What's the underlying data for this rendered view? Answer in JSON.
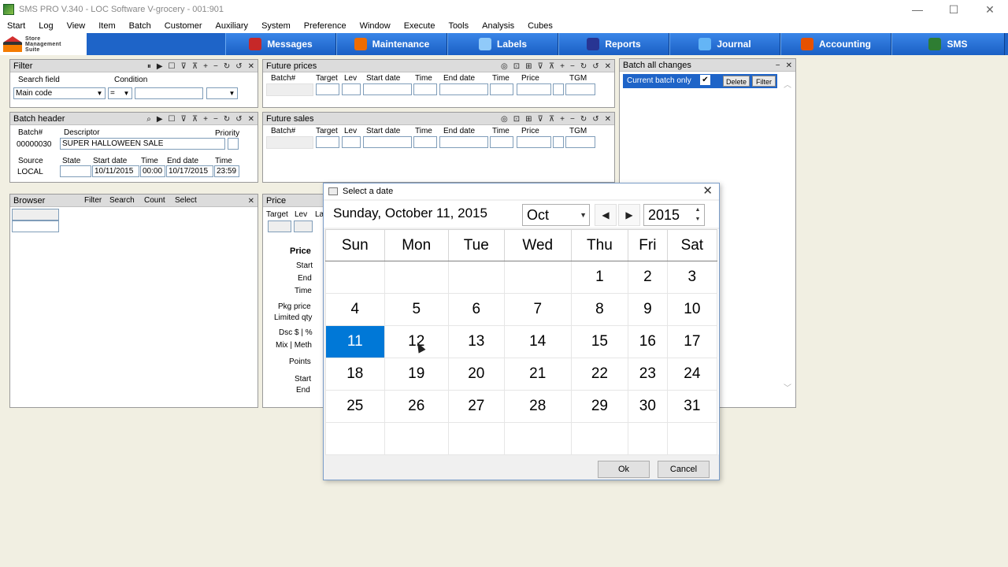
{
  "window": {
    "title": "SMS PRO V.340 - LOC Software V-grocery - 001:901",
    "minimize": "—",
    "maximize": "☐",
    "close": "✕"
  },
  "menu": [
    "Start",
    "Log",
    "View",
    "Item",
    "Batch",
    "Customer",
    "Auxiliary",
    "System",
    "Preference",
    "Window",
    "Execute",
    "Tools",
    "Analysis",
    "Cubes"
  ],
  "logo": {
    "line1": "Store",
    "line2": "Management",
    "line3": "Suite"
  },
  "toolbar": [
    {
      "label": "Messages",
      "color": "#c62828"
    },
    {
      "label": "Maintenance",
      "color": "#ef6c00"
    },
    {
      "label": "Labels",
      "color": "#1565c0"
    },
    {
      "label": "Reports",
      "color": "#283593"
    },
    {
      "label": "Journal",
      "color": "#1976d2"
    },
    {
      "label": "Accounting",
      "color": "#e65100"
    },
    {
      "label": "SMS",
      "color": "#2e7d32"
    }
  ],
  "filter": {
    "title": "Filter",
    "search_field_label": "Search field",
    "condition_label": "Condition",
    "search_field_value": "Main code",
    "condition_value": "="
  },
  "batch_header": {
    "title": "Batch header",
    "batch_label": "Batch#",
    "descriptor_label": "Descriptor",
    "priority_label": "Priority",
    "batch_no": "00000030",
    "descriptor": "SUPER HALLOWEEN SALE",
    "source_label": "Source",
    "state_label": "State",
    "start_date_label": "Start date",
    "time_label": "Time",
    "end_date_label": "End date",
    "time2_label": "Time",
    "source": "LOCAL",
    "start_date": "10/11/2015",
    "start_time": "00:00",
    "end_date": "10/17/2015",
    "end_time": "23:59"
  },
  "browser": {
    "title": "Browser",
    "filter": "Filter",
    "search": "Search",
    "count": "Count",
    "select": "Select"
  },
  "future_prices": {
    "title": "Future prices",
    "columns": [
      "Batch#",
      "Target",
      "Lev",
      "Start date",
      "Time",
      "End date",
      "Time",
      "Price",
      "TGM"
    ]
  },
  "future_sales": {
    "title": "Future sales",
    "columns": [
      "Batch#",
      "Target",
      "Lev",
      "Start date",
      "Time",
      "End date",
      "Time",
      "Price",
      "TGM"
    ]
  },
  "price": {
    "title": "Price",
    "col_target": "Target",
    "col_lev": "Lev",
    "col_la": "La",
    "rows": [
      "Price",
      "Start",
      "End",
      "Time",
      "Pkg price",
      "Limited qty",
      "Dsc $ | %",
      "Mix | Meth",
      "Points",
      "Start",
      "End"
    ]
  },
  "batch_changes": {
    "title": "Batch all changes",
    "current_batch_only": "Current batch only",
    "check": "✔",
    "delete": "Delete",
    "filter": "Filter"
  },
  "date_dialog": {
    "title": "Select a date",
    "selected_text": "Sunday, October 11, 2015",
    "month": "Oct",
    "year": "2015",
    "prev": "◀",
    "next": "▶",
    "days": [
      "Sun",
      "Mon",
      "Tue",
      "Wed",
      "Thu",
      "Fri",
      "Sat"
    ],
    "weeks": [
      [
        "",
        "",
        "",
        "",
        "1",
        "2",
        "3"
      ],
      [
        "4",
        "5",
        "6",
        "7",
        "8",
        "9",
        "10"
      ],
      [
        "11",
        "12",
        "13",
        "14",
        "15",
        "16",
        "17"
      ],
      [
        "18",
        "19",
        "20",
        "21",
        "22",
        "23",
        "24"
      ],
      [
        "25",
        "26",
        "27",
        "28",
        "29",
        "30",
        "31"
      ],
      [
        "",
        "",
        "",
        "",
        "",
        "",
        ""
      ]
    ],
    "selected_day": "11",
    "ok": "Ok",
    "cancel": "Cancel"
  },
  "colors": {
    "toolbar_blue": "#1e64c8",
    "selection_blue": "#0078d7",
    "batch_header_blue": "#1e64c8"
  }
}
